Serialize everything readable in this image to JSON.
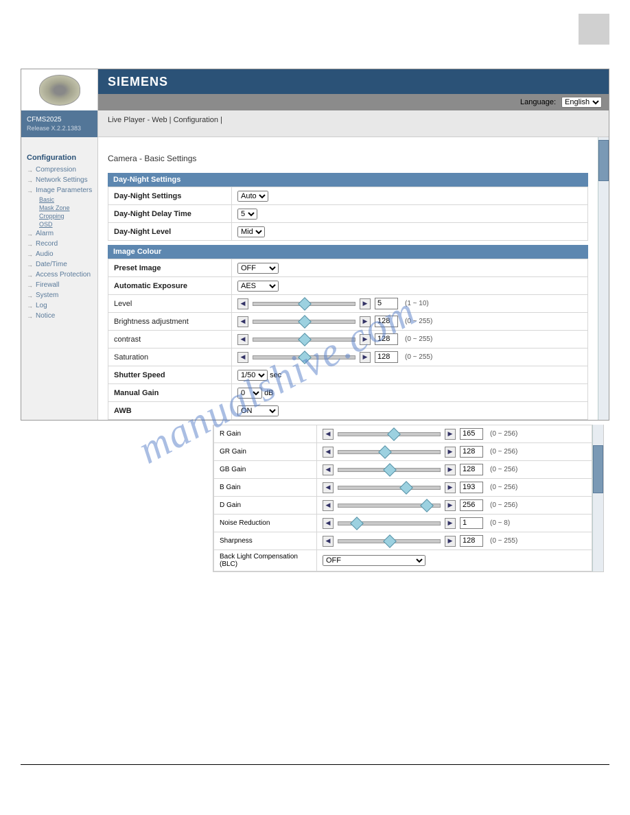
{
  "header": {
    "brand": "SIEMENS",
    "language_label": "Language:",
    "language_value": "English",
    "model": "CFMS2025",
    "release": "Release X.2.2.1383",
    "breadcrumb": "Live Player - Web  | Configuration  |"
  },
  "sidebar": {
    "title": "Configuration",
    "items": [
      {
        "label": "Compression"
      },
      {
        "label": "Network Settings"
      },
      {
        "label": "Image Parameters",
        "sub": [
          "Basic",
          "Mask Zone",
          "Cropping",
          "OSD"
        ]
      },
      {
        "label": "Alarm"
      },
      {
        "label": "Record"
      },
      {
        "label": "Audio"
      },
      {
        "label": "Date/Time"
      },
      {
        "label": "Access Protection"
      },
      {
        "label": "Firewall"
      },
      {
        "label": "System"
      },
      {
        "label": "Log"
      },
      {
        "label": "Notice"
      }
    ]
  },
  "main": {
    "heading": "Camera - Basic Settings",
    "section1": {
      "title": "Day-Night Settings",
      "rows": {
        "dn_settings": {
          "label": "Day-Night Settings",
          "value": "Auto"
        },
        "dn_delay": {
          "label": "Day-Night Delay Time",
          "value": "5"
        },
        "dn_level": {
          "label": "Day-Night Level",
          "value": "Mid"
        }
      }
    },
    "section2": {
      "title": "Image Colour",
      "preset": {
        "label": "Preset Image",
        "value": "OFF"
      },
      "ae": {
        "label": "Automatic Exposure",
        "value": "AES"
      },
      "level": {
        "label": "Level",
        "value": "5",
        "range": "(1 ~ 10)",
        "pos": 50
      },
      "brightness": {
        "label": "Brightness adjustment",
        "value": "128",
        "range": "(0 ~ 255)",
        "pos": 50
      },
      "contrast": {
        "label": "contrast",
        "value": "128",
        "range": "(0 ~ 255)",
        "pos": 50
      },
      "saturation": {
        "label": "Saturation",
        "value": "128",
        "range": "(0 ~ 255)",
        "pos": 50
      },
      "shutter": {
        "label": "Shutter Speed",
        "value": "1/50",
        "unit": "sec"
      },
      "gain": {
        "label": "Manual Gain",
        "value": "0",
        "unit": "dB"
      },
      "awb": {
        "label": "AWB",
        "value": "ON"
      }
    }
  },
  "lower": {
    "rgain": {
      "label": "R Gain",
      "value": "165",
      "range": "(0 ~ 256)",
      "pos": 55
    },
    "grgain": {
      "label": "GR Gain",
      "value": "128",
      "range": "(0 ~ 256)",
      "pos": 45
    },
    "gbgain": {
      "label": "GB Gain",
      "value": "128",
      "range": "(0 ~ 256)",
      "pos": 50
    },
    "bgain": {
      "label": "B Gain",
      "value": "193",
      "range": "(0 ~ 256)",
      "pos": 68
    },
    "dgain": {
      "label": "D Gain",
      "value": "256",
      "range": "(0 ~ 256)",
      "pos": 90
    },
    "nr": {
      "label": "Noise Reduction",
      "value": "1",
      "range": "(0 ~ 8)",
      "pos": 15
    },
    "sharp": {
      "label": "Sharpness",
      "value": "128",
      "range": "(0 ~ 255)",
      "pos": 50
    },
    "blc": {
      "label": "Back Light Compensation (BLC)",
      "value": "OFF"
    }
  },
  "watermark": "manualshive.com"
}
